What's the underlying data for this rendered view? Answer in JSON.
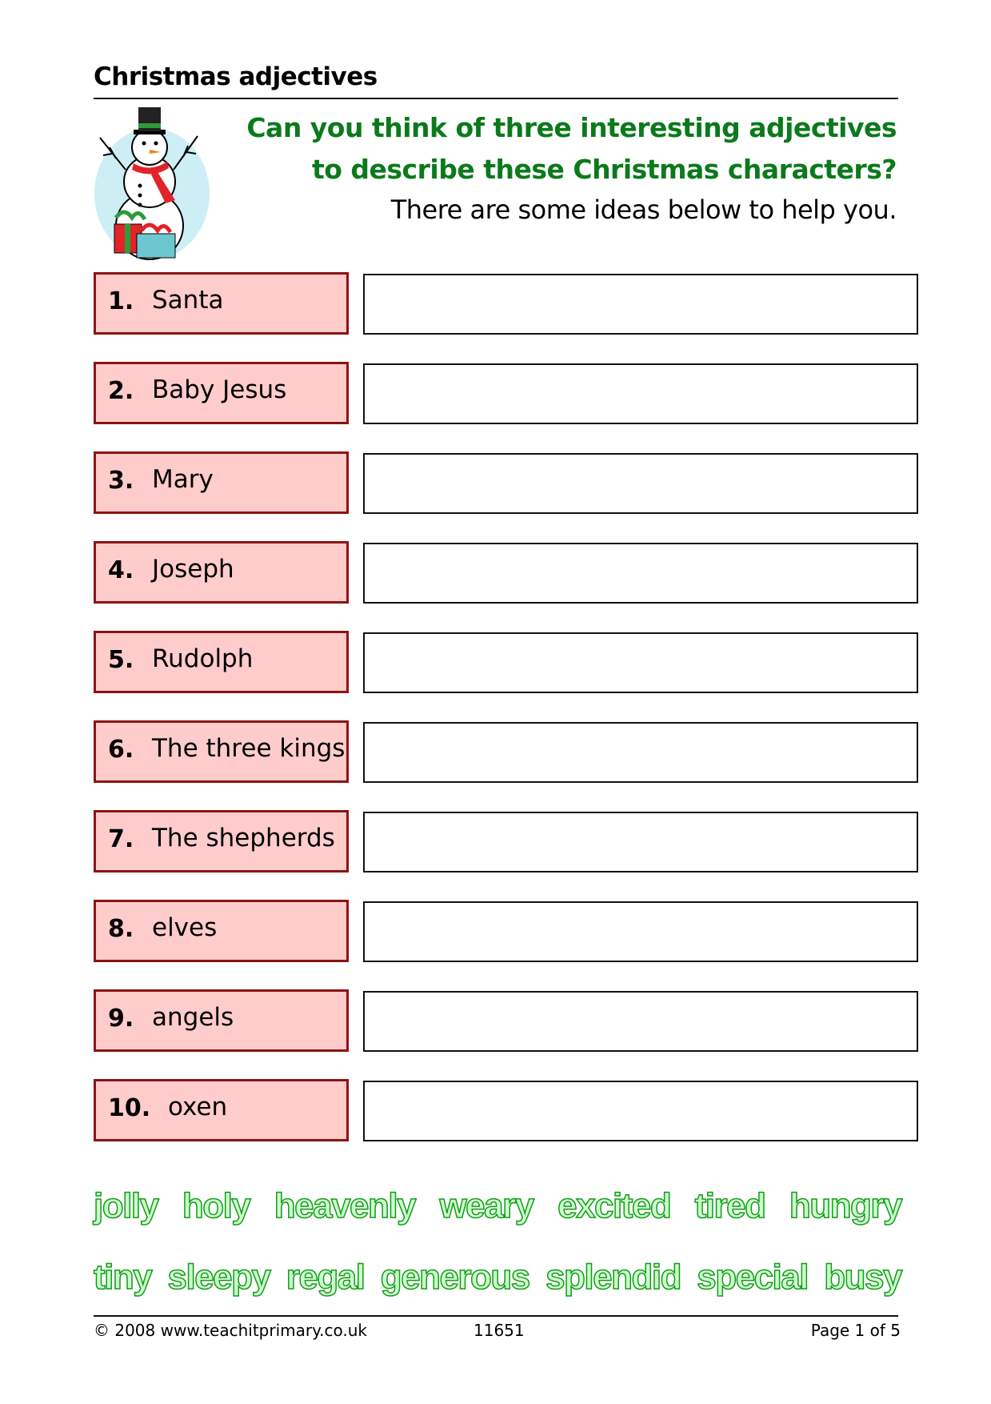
{
  "header": {
    "title": "Christmas adjectives"
  },
  "intro": {
    "question_line1": "Can you think of three interesting adjectives",
    "question_line2": "to describe these Christmas characters?",
    "hint": "There are some ideas below to help you."
  },
  "items": [
    {
      "num": "1.",
      "name": "Santa",
      "answer": ""
    },
    {
      "num": "2.",
      "name": "Baby Jesus",
      "answer": ""
    },
    {
      "num": "3.",
      "name": "Mary",
      "answer": ""
    },
    {
      "num": "4.",
      "name": "Joseph",
      "answer": ""
    },
    {
      "num": "5.",
      "name": "Rudolph",
      "answer": ""
    },
    {
      "num": "6.",
      "name": "The three kings",
      "answer": ""
    },
    {
      "num": "7.",
      "name": "The shepherds",
      "answer": ""
    },
    {
      "num": "8.",
      "name": "elves",
      "answer": ""
    },
    {
      "num": "9.",
      "name": "angels",
      "answer": ""
    },
    {
      "num": "10.",
      "name": "oxen",
      "answer": ""
    }
  ],
  "word_bank": {
    "row1": [
      "jolly",
      "holy",
      "heavenly",
      "weary",
      "excited",
      "tired",
      "hungry"
    ],
    "row2": [
      "tiny",
      "sleepy",
      "regal",
      "generous",
      "splendid",
      "special",
      "busy"
    ]
  },
  "footer": {
    "copyright": "© 2008 www.teachitprimary.co.uk",
    "code": "11651",
    "page": "Page 1 of 5"
  },
  "colors": {
    "heading_green": "#0b7a1c",
    "label_fill": "#ffcccc",
    "label_border": "#8b1414",
    "word_fill": "#ccffcc",
    "word_outline": "#139a1a"
  },
  "images": {
    "snowman": "snowman-with-presents-clipart"
  }
}
